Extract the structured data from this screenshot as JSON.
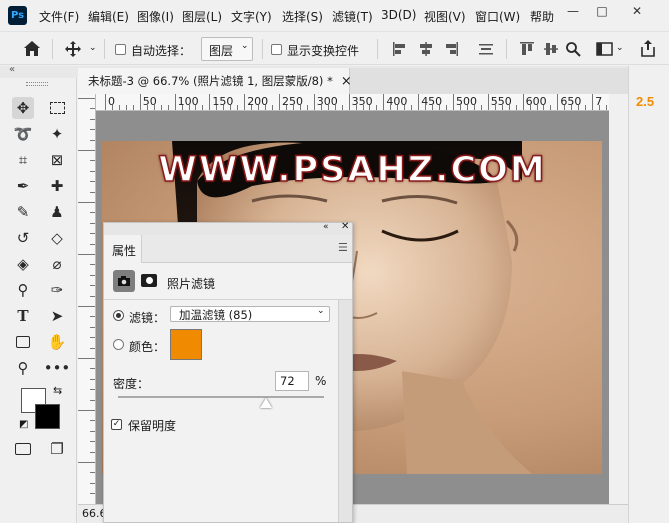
{
  "app": {
    "logo": "Ps"
  },
  "menu": [
    "文件(F)",
    "编辑(E)",
    "图像(I)",
    "图层(L)",
    "文字(Y)",
    "选择(S)",
    "滤镜(T)",
    "3D(D)",
    "视图(V)",
    "窗口(W)",
    "帮助"
  ],
  "window_controls": {
    "minimize": "—",
    "maximize": "□",
    "close": "✕"
  },
  "options": {
    "auto_select_label": "自动选择：",
    "layer_select_value": "图层",
    "show_transform_label": "显示变换控件"
  },
  "document": {
    "tab_title": "未标题-3 @ 66.7% (照片滤镜 1, 图层蒙版/8) *",
    "tab_close": "×",
    "zoom_status": "66.67%"
  },
  "ruler": {
    "ticks": [
      "0",
      "50",
      "100",
      "150",
      "200",
      "250",
      "300",
      "350",
      "400",
      "450",
      "500",
      "550",
      "600",
      "650",
      "7"
    ]
  },
  "watermark": "WWW.PSAHZ.COM",
  "right_panel": {
    "value": "2.5"
  },
  "properties": {
    "tab_label": "属性",
    "panel_title": "照片滤镜",
    "filter_label": "滤镜：",
    "filter_value": "加温滤镜 (85)",
    "color_label": "颜色：",
    "density_label": "密度：",
    "density_value": "72",
    "density_unit": "%",
    "density_fraction": 0.72,
    "preserve_label": "保留明度",
    "filter_color": "#f08a00"
  },
  "colors": {
    "watermark_text": "#ffffff",
    "watermark_outline": "#8a1a1a"
  }
}
